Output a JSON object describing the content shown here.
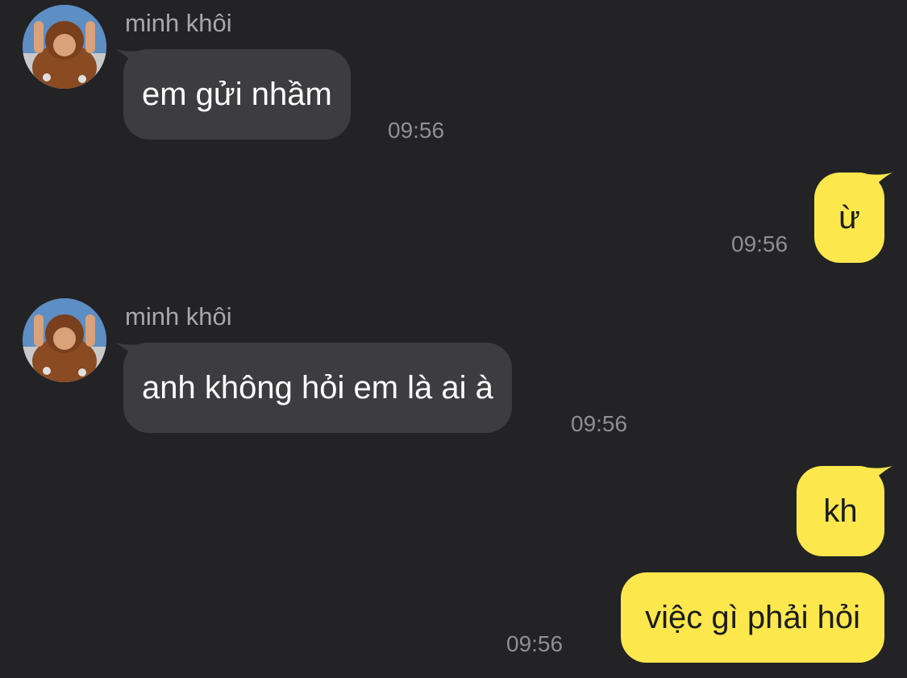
{
  "colors": {
    "background": "#232325",
    "incoming_bubble": "#3d3d40",
    "outgoing_bubble": "#fce84c",
    "sender_name": "#a8a8ac",
    "timestamp": "#8e8e93"
  },
  "messages": [
    {
      "direction": "incoming",
      "sender": "minh khôi",
      "text": "em gửi nhầm",
      "time": "09:56",
      "avatar": "user-avatar"
    },
    {
      "direction": "outgoing",
      "text": "ừ",
      "time": "09:56"
    },
    {
      "direction": "incoming",
      "sender": "minh khôi",
      "text": "anh không hỏi em là ai à",
      "time": "09:56",
      "avatar": "user-avatar"
    },
    {
      "direction": "outgoing",
      "text": "kh"
    },
    {
      "direction": "outgoing",
      "text": "việc gì phải hỏi",
      "time": "09:56"
    }
  ]
}
